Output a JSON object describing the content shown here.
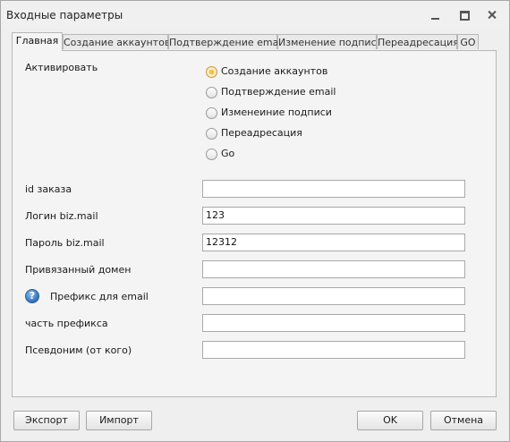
{
  "window": {
    "title": "Входные параметры"
  },
  "tabs": [
    {
      "label": "Главная"
    },
    {
      "label": "Создание аккаунтов"
    },
    {
      "label": "Подтверждение email"
    },
    {
      "label": "Изменение подписи"
    },
    {
      "label": "Переадресация"
    },
    {
      "label": "GO"
    }
  ],
  "activate": {
    "label": "Активировать",
    "options": [
      {
        "label": "Создание аккаунтов",
        "selected": true
      },
      {
        "label": "Подтверждение email",
        "selected": false
      },
      {
        "label": "Изменеиние подписи",
        "selected": false
      },
      {
        "label": "Переадресация",
        "selected": false
      },
      {
        "label": "Go",
        "selected": false
      }
    ]
  },
  "fields": [
    {
      "label": "id заказа",
      "value": ""
    },
    {
      "label": "Логин biz.mail",
      "value": "123"
    },
    {
      "label": "Пароль biz.mail",
      "value": "12312"
    },
    {
      "label": "Привязанный домен",
      "value": ""
    },
    {
      "label": "Префикс для email",
      "value": ""
    },
    {
      "label": "часть префикса",
      "value": ""
    },
    {
      "label": "Псевдоним (от кого)",
      "value": ""
    }
  ],
  "icons": {
    "help": "help-icon",
    "help_glyph": "?"
  },
  "buttons": {
    "export": "Экспорт",
    "import": "Импорт",
    "ok": "OK",
    "cancel": "Отмена"
  },
  "colors": {
    "radio_selected": "#f6c24a",
    "help_icon": "#2f6fb6"
  }
}
